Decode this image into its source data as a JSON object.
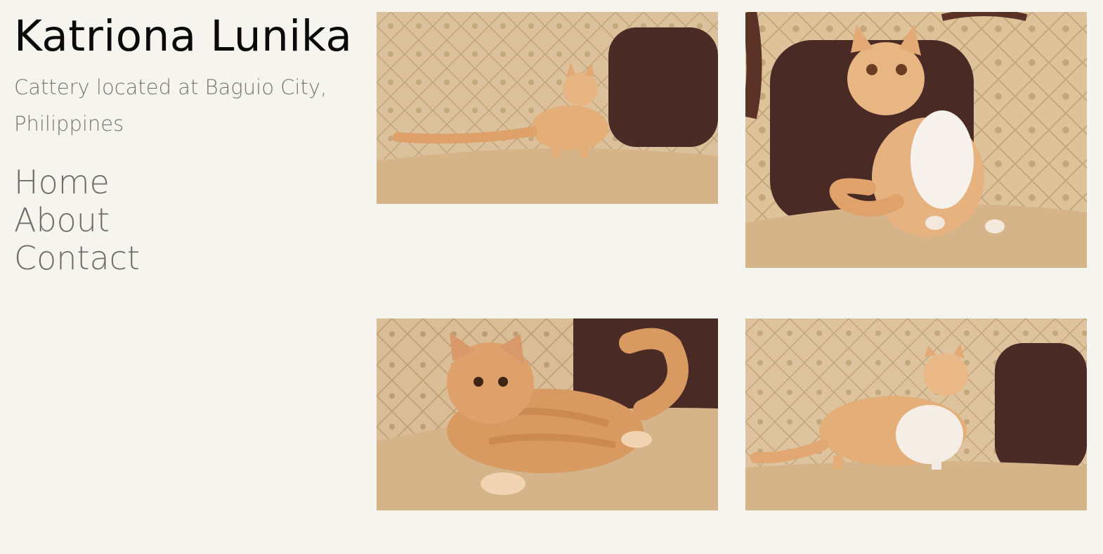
{
  "site": {
    "title": "Katriona Lunika",
    "tagline": "Cattery located at Baguio City, Philippines"
  },
  "nav": {
    "items": [
      {
        "label": "Home"
      },
      {
        "label": "About"
      },
      {
        "label": "Contact"
      }
    ]
  },
  "gallery": {
    "photos": [
      {
        "subject": "cream tabby exotic shorthair kitten standing on sofa beside dark pillow"
      },
      {
        "subject": "cream and white exotic shorthair kitten sitting in front of dark pillow"
      },
      {
        "subject": "red tabby exotic shorthair cat lying on sofa"
      },
      {
        "subject": "cream and white exotic shorthair kitten walking on sofa"
      }
    ]
  },
  "colors": {
    "background": "#f6f4ef",
    "title": "#0a0a0a",
    "muted_text": "#777570",
    "sofa": "#d9bd93",
    "pillow": "#4a2a24",
    "cat_cream": "#e0a66d"
  }
}
